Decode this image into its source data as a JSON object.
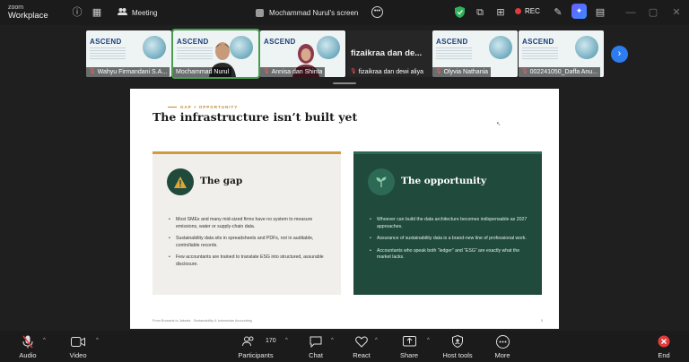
{
  "app": {
    "brand_top": "zoom",
    "brand_bottom": "Workplace"
  },
  "topbar": {
    "meeting_label": "Meeting",
    "screen_share_label": "Mochammad Nurul's screen",
    "rec_label": "REC",
    "colors": {
      "rec": "#e23b3b",
      "shield": "#2fb35a",
      "ai": "#6a5cff"
    }
  },
  "thumbnails": [
    {
      "name": "Wahyu Firmandani S.A...",
      "muted": true,
      "title": "ASCEND"
    },
    {
      "name": "Mochammad Nurul",
      "muted": false,
      "title": "ASCEND",
      "active": true
    },
    {
      "name": "Annisa dan Shinta",
      "muted": true,
      "title": "ASCEND"
    },
    {
      "name": "fizaikraa dan dewi aliya",
      "muted": true,
      "big": "fizaikraa dan de..."
    },
    {
      "name": "Olyvia Nathania",
      "muted": true,
      "title": "ASCEND"
    },
    {
      "name": "002241050_Daffa Anu...",
      "muted": true,
      "title": "ASCEND"
    }
  ],
  "slide": {
    "eyebrow": "GAP + OPPORTUNITY",
    "title": "The infrastructure isn’t built yet",
    "gap": {
      "title": "The gap",
      "bullets": [
        "Most SMEs and many mid-sized firms have no system to measure emissions, water or supply-chain data.",
        "Sustainability data sits in spreadsheets and PDFs, not in auditable, controllable records.",
        "Few accountants are trained to translate ESG into structured, assurable disclosure."
      ]
    },
    "opportunity": {
      "title": "The opportunity",
      "bullets": [
        "Whoever can build the data architecture becomes indispensable as 2027 approaches.",
        "Assurance of sustainability data is a brand-new line of professional work.",
        "Accountants who speak both “ledger” and “ESG” are exactly what the market lacks."
      ]
    },
    "footer_left": "From Brussels to Jakarta · Sustainability & Indonesian Accounting",
    "footer_right": "5",
    "colors": {
      "accent": "#b98a2e",
      "gap_bg": "#f0efec",
      "opp_bg": "#1f4a3c"
    }
  },
  "toolbar": {
    "audio": "Audio",
    "video": "Video",
    "participants": "Participants",
    "participants_count": "170",
    "chat": "Chat",
    "react": "React",
    "share": "Share",
    "host_tools": "Host tools",
    "more": "More",
    "end": "End"
  }
}
